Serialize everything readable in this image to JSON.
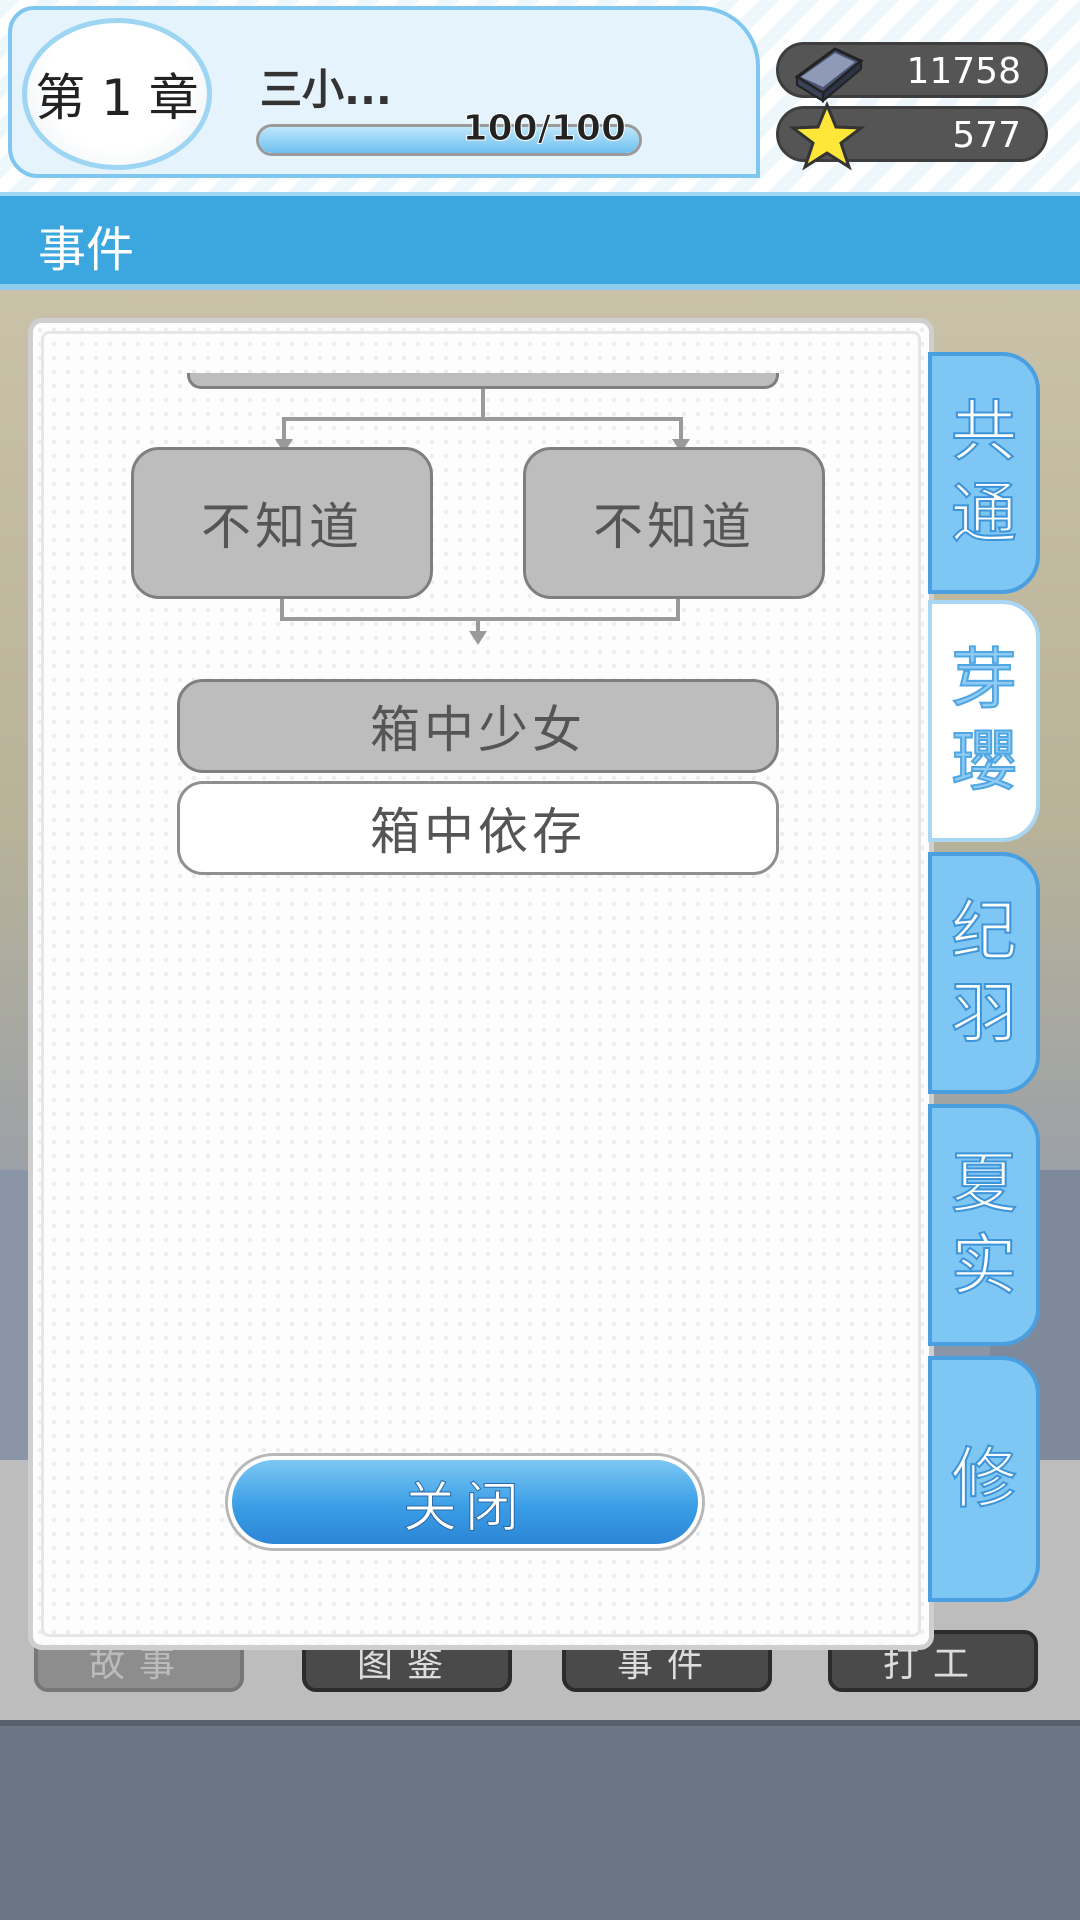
{
  "header": {
    "chapter_label": "第 1 章",
    "chapter_name": "三小...",
    "progress_text": "100/100",
    "progress_fraction": 1.0
  },
  "currencies": [
    {
      "icon": "gem-block-icon",
      "value": "11758"
    },
    {
      "icon": "star-icon",
      "value": "577"
    }
  ],
  "title_bar": {
    "label": "事件"
  },
  "flow": {
    "choice_left": "不知道",
    "choice_right": "不知道",
    "node_locked": "箱中少女",
    "node_current": "箱中依存"
  },
  "close_label": "关闭",
  "tabs": [
    {
      "label_top": "共",
      "label_bottom": "通"
    },
    {
      "label_top": "芽",
      "label_bottom": "瓔"
    },
    {
      "label_top": "纪",
      "label_bottom": "羽"
    },
    {
      "label_top": "夏",
      "label_bottom": "实"
    },
    {
      "label_top": "修",
      "label_bottom": ""
    }
  ],
  "bottom_nav": [
    "故事",
    "图鉴",
    "事件",
    "打工"
  ],
  "colors": {
    "accent": "#3ba7de",
    "tab_bg": "#7ec6f3",
    "node_gray": "#bdbdbd"
  }
}
